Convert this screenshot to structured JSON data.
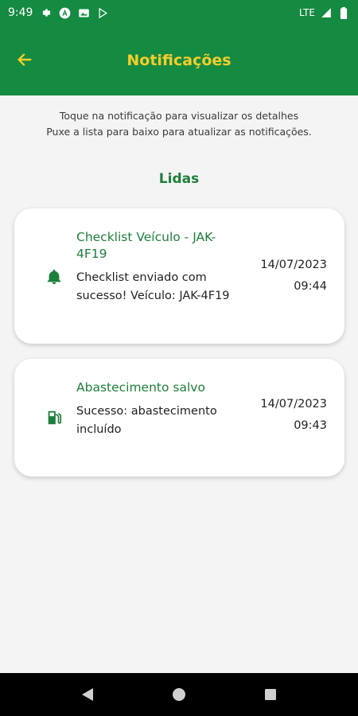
{
  "status_bar": {
    "time": "9:49",
    "network": "LTE"
  },
  "app_bar": {
    "title": "Notificações",
    "back_icon": "arrow-left-icon"
  },
  "hint": {
    "line1": "Toque na notificação para visualizar os detalhes",
    "line2": "Puxe a lista para baixo para atualizar as notificações."
  },
  "section": {
    "title": "Lidas"
  },
  "notifications": [
    {
      "icon": "bell-icon",
      "title": "Checklist Veículo - JAK-4F19",
      "body": "Checklist enviado com sucesso! Veículo: JAK-4F19",
      "date": "14/07/2023",
      "time": "09:44"
    },
    {
      "icon": "fuel-pump-icon",
      "title": "Abastecimento salvo",
      "body": "Sucesso: abastecimento incluído",
      "date": "14/07/2023",
      "time": "09:43"
    }
  ],
  "colors": {
    "primary": "#158a41",
    "accent": "#f3cd2b",
    "text_green": "#1d7f3c",
    "background": "#f4f4f4"
  }
}
